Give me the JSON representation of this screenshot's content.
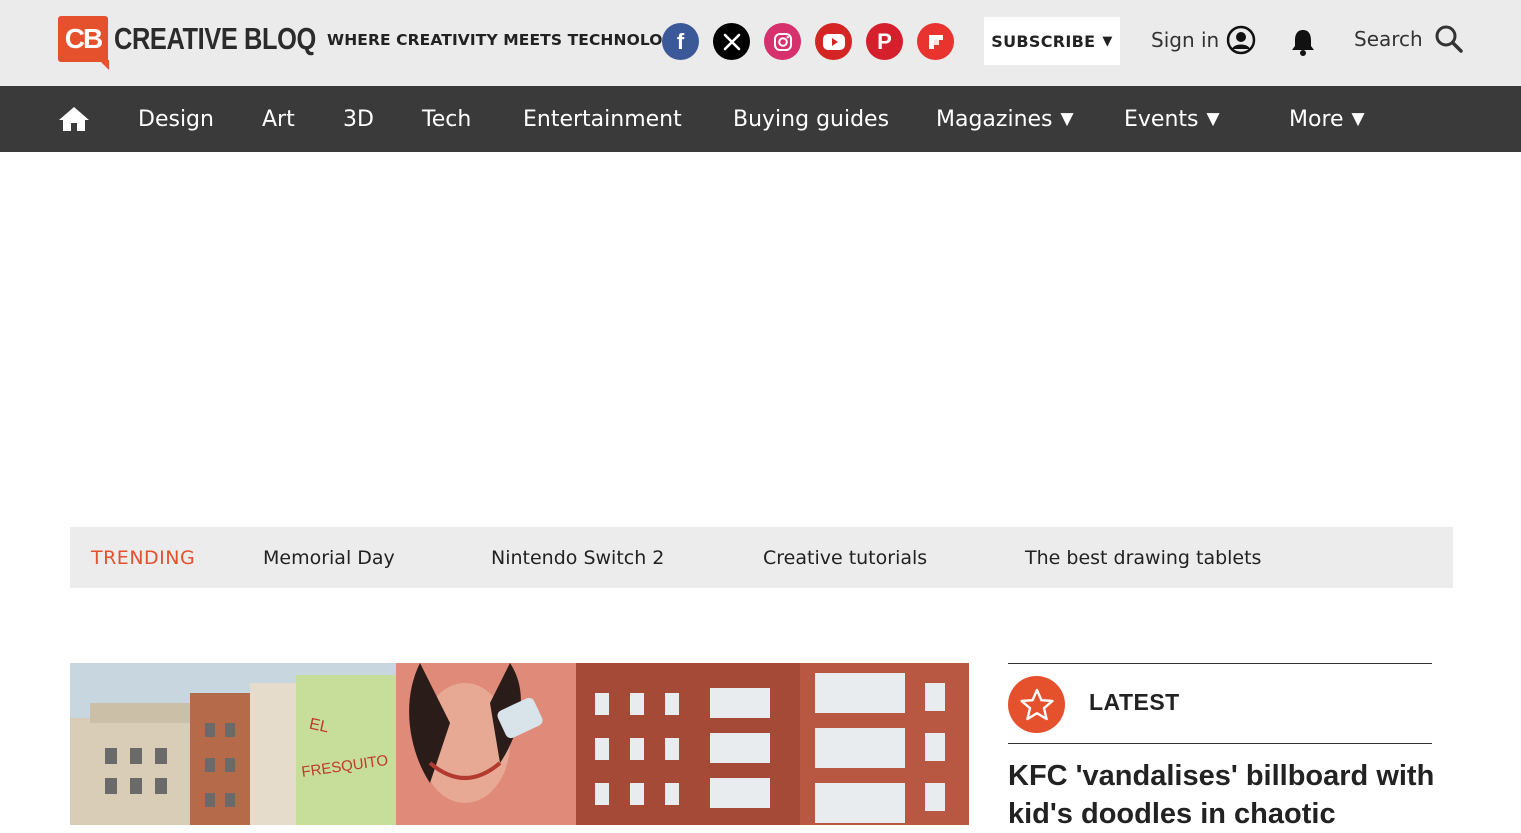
{
  "header": {
    "logo_badge": "CB",
    "logo_word": "CREATIVE BLOQ",
    "tagline": "WHERE CREATIVITY MEETS TECHNOLOGY",
    "social": [
      {
        "name": "facebook-icon",
        "glyph": "f",
        "color": "#3b5998"
      },
      {
        "name": "x-icon",
        "glyph": "X",
        "color": "#000000"
      },
      {
        "name": "instagram-icon",
        "glyph": "",
        "color": "#d6306d"
      },
      {
        "name": "youtube-icon",
        "glyph": "",
        "color": "#d42424"
      },
      {
        "name": "pinterest-icon",
        "glyph": "P",
        "color": "#d51f2c"
      },
      {
        "name": "flipboard-icon",
        "glyph": "",
        "color": "#e8332f"
      }
    ],
    "subscribe_label": "SUBSCRIBE",
    "signin_label": "Sign in",
    "search_label": "Search"
  },
  "nav": {
    "items": [
      {
        "label": "Design"
      },
      {
        "label": "Art"
      },
      {
        "label": "3D"
      },
      {
        "label": "Tech"
      },
      {
        "label": "Entertainment"
      },
      {
        "label": "Buying guides"
      },
      {
        "label": "Magazines"
      },
      {
        "label": "Events"
      },
      {
        "label": "More"
      }
    ]
  },
  "trending": {
    "label": "TRENDING",
    "items": [
      {
        "label": "Memorial Day"
      },
      {
        "label": "Nintendo Switch 2"
      },
      {
        "label": "Creative tutorials"
      },
      {
        "label": "The best drawing tablets"
      }
    ]
  },
  "latest": {
    "label": "LATEST",
    "headline": "KFC 'vandalises' billboard with kid's doodles in chaotic"
  },
  "colors": {
    "brand": "#e5512d",
    "nav_bg": "#3a3a3a",
    "header_bg": "#ebebeb"
  }
}
